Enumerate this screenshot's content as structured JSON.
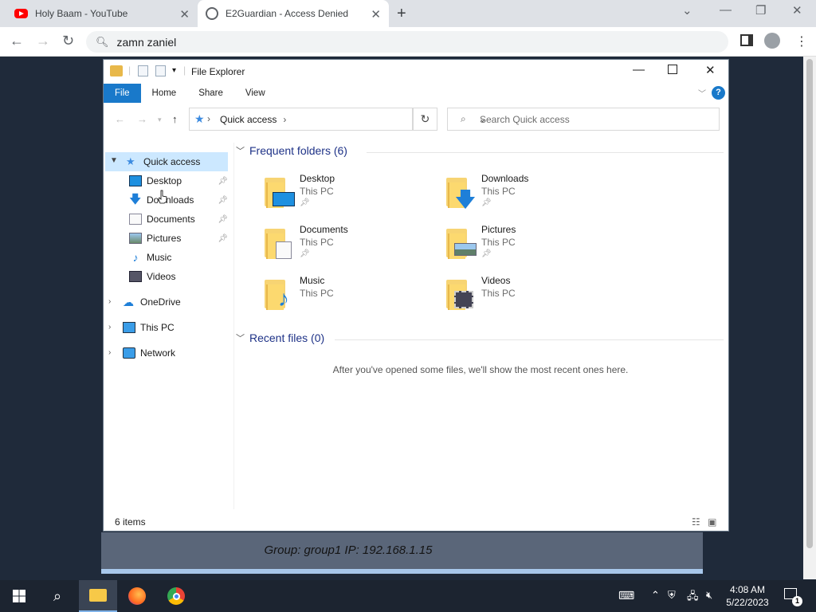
{
  "browser": {
    "tabs": [
      {
        "title": "Holy Baam - YouTube",
        "icon": "youtube-icon"
      },
      {
        "title": "E2Guardian - Access Denied",
        "icon": "globe-icon"
      }
    ],
    "address": "zamn zaniel"
  },
  "page": {
    "group_line": "Group: group1   IP: 192.168.1.15"
  },
  "explorer": {
    "title": "File Explorer",
    "ribbon_tabs": [
      "File",
      "Home",
      "Share",
      "View"
    ],
    "breadcrumb": "Quick access",
    "search_placeholder": "Search Quick access",
    "sidebar": {
      "quick_access": "Quick access",
      "pinned": [
        "Desktop",
        "Downloads",
        "Documents",
        "Pictures"
      ],
      "unpinned": [
        "Music",
        "Videos"
      ],
      "roots": [
        "OneDrive",
        "This PC",
        "Network"
      ]
    },
    "frequent_header": "Frequent folders (6)",
    "folders": [
      {
        "name": "Desktop",
        "location": "This PC",
        "pinned": true
      },
      {
        "name": "Downloads",
        "location": "This PC",
        "pinned": true
      },
      {
        "name": "Documents",
        "location": "This PC",
        "pinned": true
      },
      {
        "name": "Pictures",
        "location": "This PC",
        "pinned": true
      },
      {
        "name": "Music",
        "location": "This PC",
        "pinned": false
      },
      {
        "name": "Videos",
        "location": "This PC",
        "pinned": false
      }
    ],
    "recent_header": "Recent files (0)",
    "recent_empty": "After you've opened some files, we'll show the most recent ones here.",
    "status": "6 items"
  },
  "taskbar": {
    "time": "4:08 AM",
    "date": "5/22/2023",
    "notification_count": "1"
  },
  "colors": {
    "accent": "#1979ca",
    "selection": "#cce8ff",
    "header_blue": "#1e3287",
    "folder_yellow": "#fcd96f"
  }
}
